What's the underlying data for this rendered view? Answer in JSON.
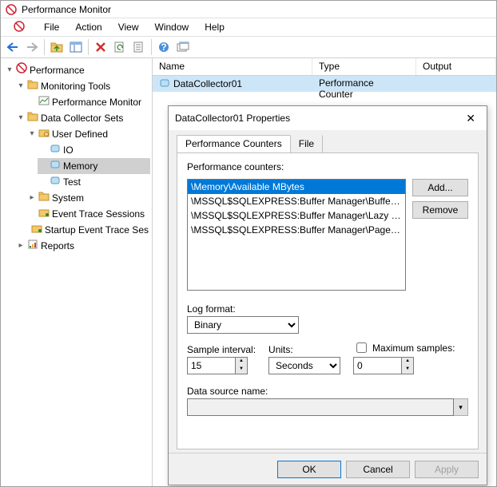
{
  "window": {
    "title": "Performance Monitor"
  },
  "menu": {
    "file": "File",
    "action": "Action",
    "view": "View",
    "window": "Window",
    "help": "Help"
  },
  "tree": {
    "root": "Performance",
    "monitoring": "Monitoring Tools",
    "perfmon": "Performance Monitor",
    "dcs": "Data Collector Sets",
    "userdef": "User Defined",
    "io": "IO",
    "memory": "Memory",
    "test": "Test",
    "system": "System",
    "ets": "Event Trace Sessions",
    "sets": "Startup Event Trace Ses",
    "reports": "Reports"
  },
  "list": {
    "col_name": "Name",
    "col_type": "Type",
    "col_output": "Output",
    "row_name": "DataCollector01",
    "row_type": "Performance Counter"
  },
  "dialog": {
    "title": "DataCollector01 Properties",
    "tab_perf": "Performance Counters",
    "tab_file": "File",
    "label_counters": "Performance counters:",
    "counters": [
      "\\Memory\\Available MBytes",
      "\\MSSQL$SQLEXPRESS:Buffer Manager\\Buffer ca...",
      "\\MSSQL$SQLEXPRESS:Buffer Manager\\Lazy writ...",
      "\\MSSQL$SQLEXPRESS:Buffer Manager\\Page life ..."
    ],
    "btn_add": "Add...",
    "btn_remove": "Remove",
    "label_logformat": "Log format:",
    "logformat": "Binary",
    "label_sample": "Sample interval:",
    "sample": "15",
    "label_units": "Units:",
    "units": "Seconds",
    "label_max": "Maximum samples:",
    "max": "0",
    "label_dsn": "Data source name:",
    "dsn": "",
    "btn_ok": "OK",
    "btn_cancel": "Cancel",
    "btn_apply": "Apply"
  }
}
